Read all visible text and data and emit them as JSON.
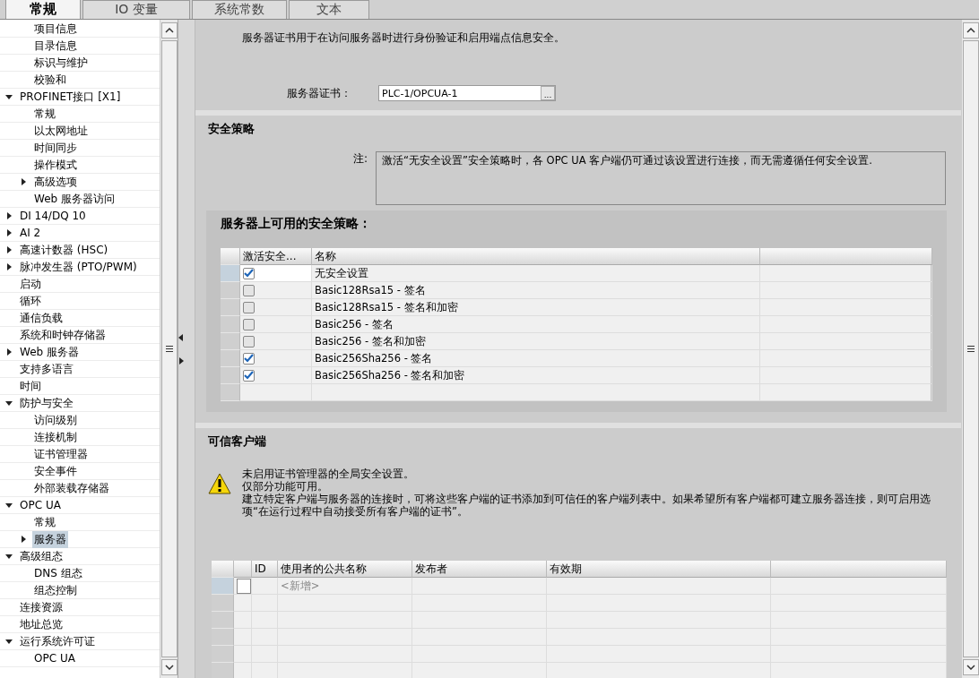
{
  "tabs": [
    {
      "label": "常规",
      "selected": true
    },
    {
      "label": "IO 变量",
      "selected": false
    },
    {
      "label": "系统常数",
      "selected": false
    },
    {
      "label": "文本",
      "selected": false
    }
  ],
  "tree": {
    "leading_children": [
      {
        "label": "项目信息",
        "selected": false
      },
      {
        "label": "目录信息",
        "selected": false
      },
      {
        "label": "标识与维护",
        "selected": false
      },
      {
        "label": "校验和",
        "selected": false
      }
    ],
    "items": [
      {
        "label": "PROFINET接口 [X1]",
        "expanded": true,
        "selected": false,
        "children": [
          {
            "label": "常规",
            "selected": false
          },
          {
            "label": "以太网地址",
            "selected": false
          },
          {
            "label": "时间同步",
            "selected": false
          },
          {
            "label": "操作模式",
            "selected": false
          },
          {
            "label": "高级选项",
            "expanded": false,
            "selected": false
          },
          {
            "label": "Web 服务器访问",
            "selected": false
          }
        ]
      },
      {
        "label": "DI 14/DQ 10",
        "expanded": false,
        "selected": false
      },
      {
        "label": "AI 2",
        "expanded": false,
        "selected": false
      },
      {
        "label": "高速计数器 (HSC)",
        "expanded": false,
        "selected": false
      },
      {
        "label": "脉冲发生器 (PTO/PWM)",
        "expanded": false,
        "selected": false
      },
      {
        "label": "启动",
        "selected": false
      },
      {
        "label": "循环",
        "selected": false
      },
      {
        "label": "通信负载",
        "selected": false
      },
      {
        "label": "系统和时钟存储器",
        "selected": false
      },
      {
        "label": "Web 服务器",
        "expanded": false,
        "selected": false
      },
      {
        "label": "支持多语言",
        "selected": false
      },
      {
        "label": "时间",
        "selected": false
      },
      {
        "label": "防护与安全",
        "expanded": true,
        "selected": false,
        "children": [
          {
            "label": "访问级别",
            "selected": false
          },
          {
            "label": "连接机制",
            "selected": false
          },
          {
            "label": "证书管理器",
            "selected": false
          },
          {
            "label": "安全事件",
            "selected": false
          },
          {
            "label": "外部装载存储器",
            "selected": false
          }
        ]
      },
      {
        "label": "OPC UA",
        "expanded": true,
        "selected": false,
        "children": [
          {
            "label": "常规",
            "selected": false
          },
          {
            "label": "服务器",
            "expanded": false,
            "selected": true
          }
        ]
      },
      {
        "label": "高级组态",
        "expanded": true,
        "selected": false,
        "children": [
          {
            "label": "DNS 组态",
            "selected": false
          },
          {
            "label": "组态控制",
            "selected": false
          }
        ]
      },
      {
        "label": "连接资源",
        "selected": false
      },
      {
        "label": "地址总览",
        "selected": false
      },
      {
        "label": "运行系统许可证",
        "expanded": true,
        "selected": false,
        "children": [
          {
            "label": "OPC UA",
            "selected": false
          }
        ]
      }
    ]
  },
  "server_certificate": {
    "description": "服务器证书用于在访问服务器时进行身份验证和启用端点信息安全。",
    "label": "服务器证书：",
    "value": "PLC-1/OPCUA-1",
    "browse_button": "..."
  },
  "security_policy": {
    "title": "安全策略",
    "note_label": "注:",
    "note": "激活“无安全设置”安全策略时，各 OPC UA 客户端仍可通过该设置进行连接，而无需遵循任何安全设置.",
    "available": {
      "title": "服务器上可用的安全策略：",
      "columns": [
        "激活安全...",
        "名称"
      ],
      "rows": [
        {
          "active": true,
          "name": "无安全设置"
        },
        {
          "active": false,
          "name": "Basic128Rsa15 - 签名"
        },
        {
          "active": false,
          "name": "Basic128Rsa15 - 签名和加密"
        },
        {
          "active": false,
          "name": "Basic256 - 签名"
        },
        {
          "active": false,
          "name": "Basic256 - 签名和加密"
        },
        {
          "active": true,
          "name": "Basic256Sha256 - 签名"
        },
        {
          "active": true,
          "name": "Basic256Sha256 - 签名和加密"
        }
      ]
    }
  },
  "trusted_clients": {
    "title": "可信客户端",
    "warning": [
      "未启用证书管理器的全局安全设置。",
      "仅部分功能可用。",
      "建立特定客户端与服务器的连接时，可将这些客户端的证书添加到可信任的客户端列表中。如果希望所有客户端都可建立服务器连接，则可启用选项“在运行过程中自动接受所有客户端的证书”。"
    ],
    "columns": [
      "ID",
      "使用者的公共名称",
      "发布者",
      "有效期"
    ],
    "add_row_placeholder": "<新增>"
  }
}
